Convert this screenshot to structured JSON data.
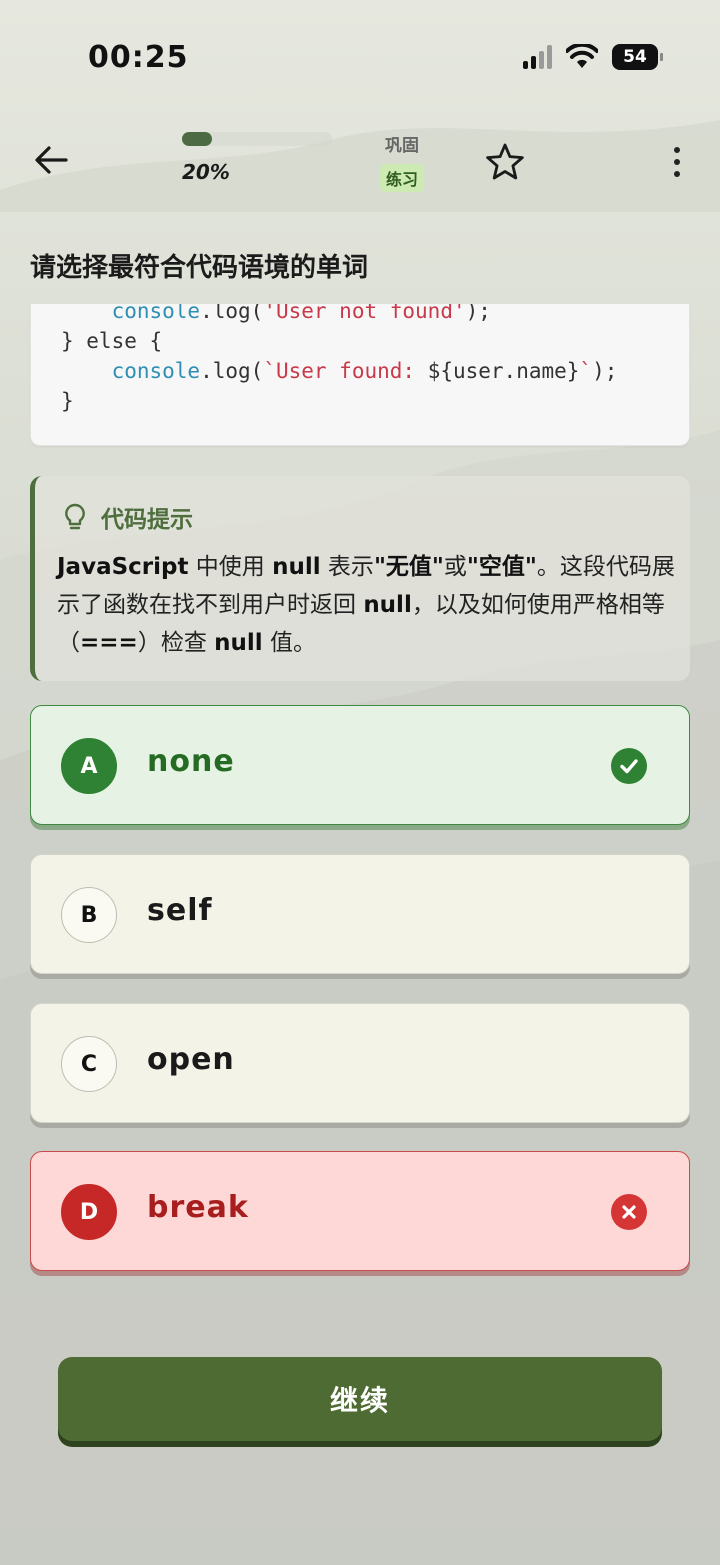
{
  "status_bar": {
    "time": "00:25",
    "battery": "54"
  },
  "top_bar": {
    "progress_label": "20%",
    "progress_value": 0.2,
    "mode_title": "巩固",
    "mode_badge": "练习",
    "icons": [
      "arrow-left-icon",
      "star-outline-icon",
      "more-vertical-icon"
    ]
  },
  "question": {
    "title": "请选择最符合代码语境的单词",
    "code_lines": [
      [
        {
          "t": "    "
        },
        {
          "t": "console",
          "k": "obj"
        },
        {
          "t": ".log("
        },
        {
          "t": "'User not found'",
          "k": "str"
        },
        {
          "t": ");"
        }
      ],
      [
        {
          "t": "} else {"
        }
      ],
      [
        {
          "t": "    "
        },
        {
          "t": "console",
          "k": "obj"
        },
        {
          "t": ".log("
        },
        {
          "t": "`User found: ",
          "k": "str"
        },
        {
          "t": "${user.name}"
        },
        {
          "t": "`",
          "k": "str"
        },
        {
          "t": ");"
        }
      ],
      [
        {
          "t": "}"
        }
      ]
    ]
  },
  "hint": {
    "title": "代码提示",
    "icon": "lightbulb-icon",
    "body_parts": [
      {
        "text": "JavaScript",
        "bold": true
      },
      {
        "text": " 中使用 ",
        "bold": false
      },
      {
        "text": "null",
        "bold": true
      },
      {
        "text": " 表示",
        "bold": false
      },
      {
        "text": "\"无值\"",
        "bold": true
      },
      {
        "text": "或",
        "bold": false
      },
      {
        "text": "\"空值\"",
        "bold": true
      },
      {
        "text": "。这段代码展示了函数在找不到用户时返回 ",
        "bold": false
      },
      {
        "text": "null",
        "bold": true
      },
      {
        "text": "，以及如何使用严格相等（",
        "bold": false
      },
      {
        "text": "===",
        "bold": true
      },
      {
        "text": "）检查 ",
        "bold": false
      },
      {
        "text": "null",
        "bold": true
      },
      {
        "text": " 值。",
        "bold": false
      }
    ]
  },
  "options": [
    {
      "letter": "A",
      "text": "none",
      "state": "correct",
      "mark_icon": "check-circle-icon"
    },
    {
      "letter": "B",
      "text": "self",
      "state": "normal",
      "mark_icon": ""
    },
    {
      "letter": "C",
      "text": "open",
      "state": "normal",
      "mark_icon": ""
    },
    {
      "letter": "D",
      "text": "break",
      "state": "wrong",
      "mark_icon": "x-circle-icon"
    }
  ],
  "continue_label": "继续",
  "colors": {
    "accent_green": "#4f6b34",
    "correct_green": "#2f8233",
    "wrong_red": "#c62828"
  }
}
